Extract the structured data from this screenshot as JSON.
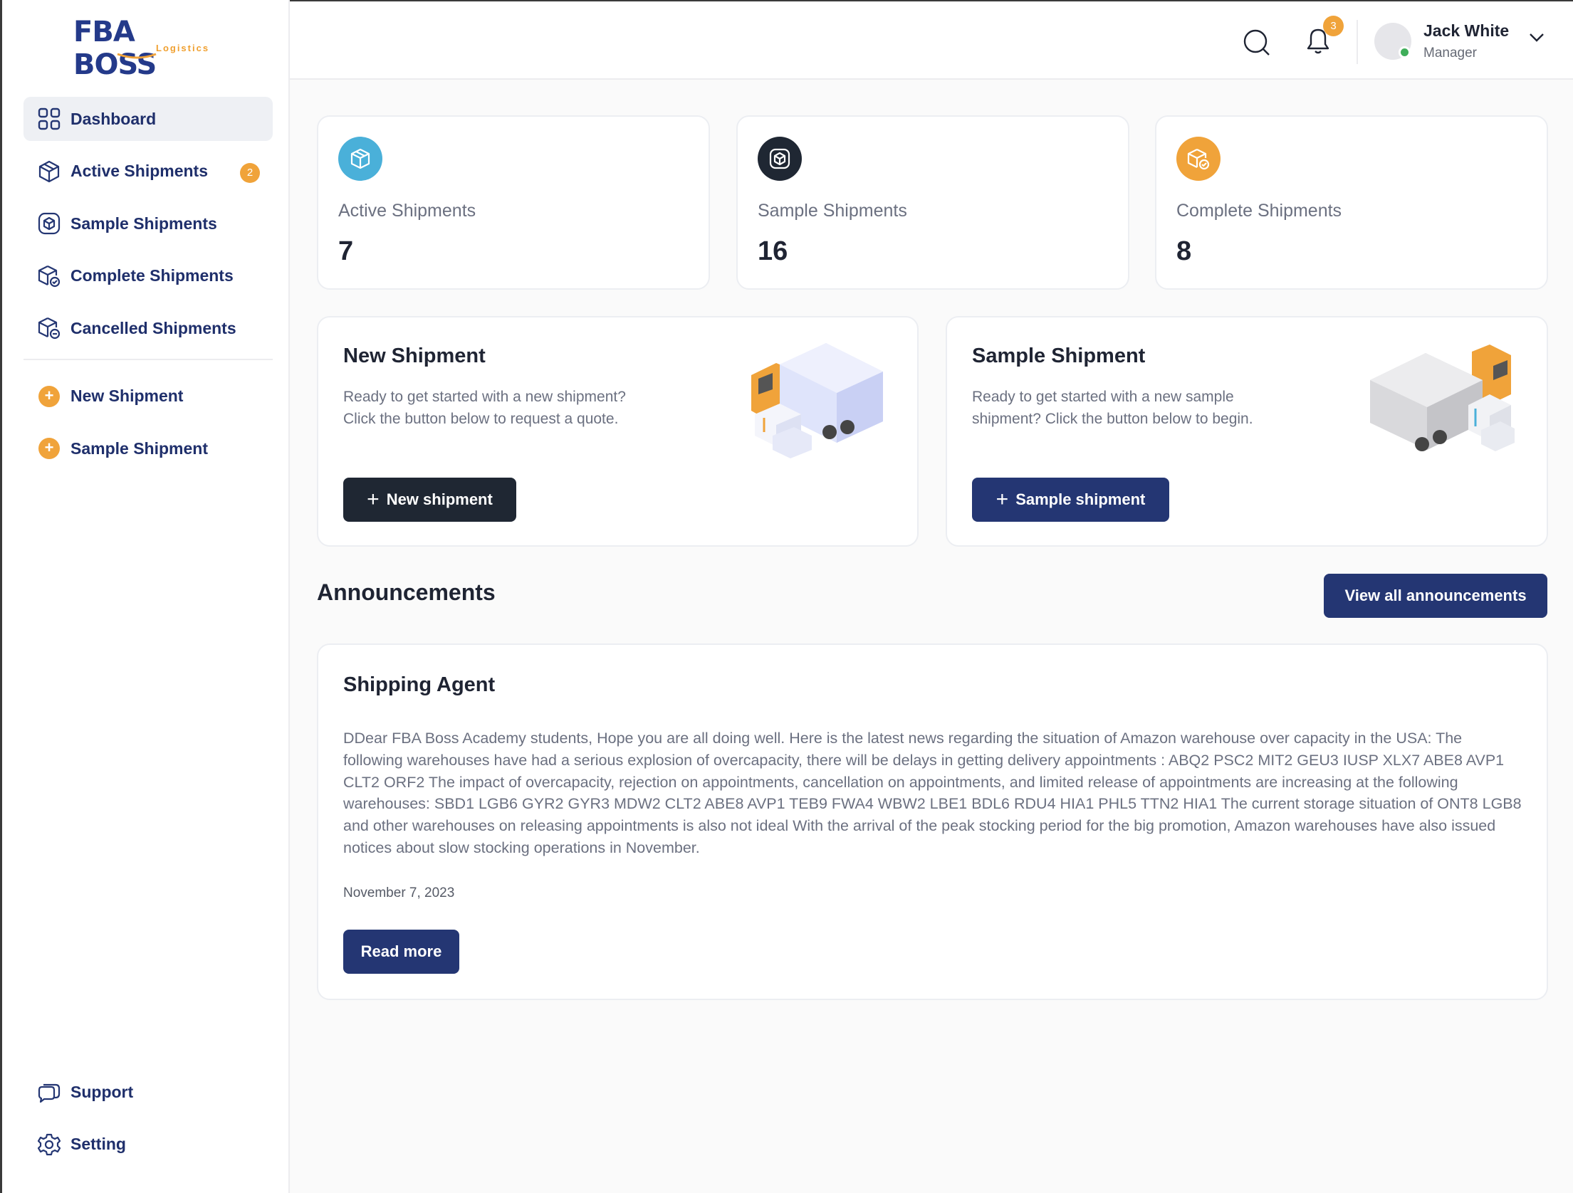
{
  "brand": {
    "logo_main": "FBA BOSS",
    "logo_sub": "Logistics",
    "accent": "#f0a33a",
    "navy": "#243673"
  },
  "sidebar": {
    "items": [
      {
        "label": "Dashboard",
        "icon": "grid-icon",
        "active": true
      },
      {
        "label": "Active Shipments",
        "icon": "box-icon",
        "badge": "2"
      },
      {
        "label": "Sample Shipments",
        "icon": "sample-box-icon"
      },
      {
        "label": "Complete Shipments",
        "icon": "box-check-icon"
      },
      {
        "label": "Cancelled Shipments",
        "icon": "box-cancel-icon"
      }
    ],
    "actions": [
      {
        "label": "New Shipment",
        "icon": "plus-circle-icon"
      },
      {
        "label": "Sample Shipment",
        "icon": "plus-circle-icon"
      }
    ],
    "bottom": [
      {
        "label": "Support",
        "icon": "chat-icon"
      },
      {
        "label": "Setting",
        "icon": "gear-icon"
      }
    ]
  },
  "header": {
    "notification_count": "3",
    "user_name": "Jack White",
    "user_role": "Manager"
  },
  "stats": [
    {
      "label": "Active Shipments",
      "value": "7",
      "icon": "box-icon",
      "color": "#4ab0d9"
    },
    {
      "label": "Sample Shipments",
      "value": "16",
      "icon": "sample-box-icon",
      "color": "#1f2733"
    },
    {
      "label": "Complete Shipments",
      "value": "8",
      "icon": "box-check-icon",
      "color": "#f0a33a"
    }
  ],
  "new_shipment": {
    "title": "New Shipment",
    "description": "Ready to get started with a new shipment? Click the button below to request a quote.",
    "button": "New shipment"
  },
  "sample_shipment": {
    "title": "Sample Shipment",
    "description": "Ready to get started with a new sample shipment? Click the button below to begin.",
    "button": "Sample shipment"
  },
  "announcements": {
    "heading": "Announcements",
    "view_all": "View all announcements",
    "card": {
      "title": "Shipping Agent",
      "body": "DDear FBA Boss Academy students, Hope you are all doing well. Here is the latest news regarding the situation of Amazon warehouse over capacity in the USA: The following warehouses have had a serious explosion of overcapacity, there will be delays in getting delivery appointments : ABQ2 PSC2 MIT2 GEU3 IUSP XLX7 ABE8 AVP1 CLT2 ORF2 The impact of overcapacity, rejection on appointments, cancellation on appointments, and limited release of appointments are increasing at the following warehouses: SBD1 LGB6 GYR2 GYR3 MDW2 CLT2 ABE8 AVP1 TEB9 FWA4 WBW2 LBE1 BDL6 RDU4 HIA1 PHL5 TTN2 HIA1 The current storage situation of ONT8 LGB8 and other warehouses on releasing appointments is also not ideal With the arrival of the peak stocking period for the big promotion, Amazon warehouses have also issued notices about slow stocking operations in November.",
      "date": "November 7, 2023",
      "button": "Read more"
    }
  }
}
